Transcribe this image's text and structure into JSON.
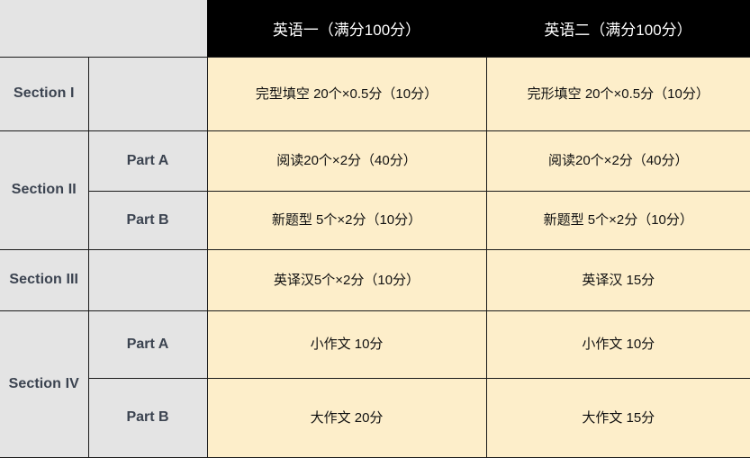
{
  "table": {
    "header": {
      "corner_label": "",
      "columns": [
        {
          "label": "英语一（满分100分）"
        },
        {
          "label": "英语二（满分100分）"
        }
      ]
    },
    "rows": [
      {
        "section": "Section I",
        "part": "",
        "english_one": "完型填空 20个×0.5分（10分）",
        "english_two": "完形填空 20个×0.5分（10分）"
      },
      {
        "section": "Section II",
        "part": "Part A",
        "english_one": "阅读20个×2分（40分）",
        "english_two": "阅读20个×2分（40分）"
      },
      {
        "section": "",
        "part": "Part B",
        "english_one": "新题型 5个×2分（10分）",
        "english_two": "新题型 5个×2分（10分）"
      },
      {
        "section": "Section III",
        "part": "",
        "english_one": "英译汉5个×2分（10分）",
        "english_two": "英译汉 15分"
      },
      {
        "section": "Section IV",
        "part": "Part A",
        "english_one": "小作文 10分",
        "english_two": "小作文 10分"
      },
      {
        "section": "",
        "part": "Part B",
        "english_one": "大作文 20分",
        "english_two": "大作文 15分"
      }
    ]
  },
  "colors": {
    "header_background": "#000000",
    "header_text": "#ffffff",
    "label_background": "#e4e4e4",
    "label_text": "#3b4350",
    "content_background": "#fdeeca",
    "content_text": "#111111",
    "border": "#1a1a1a"
  }
}
